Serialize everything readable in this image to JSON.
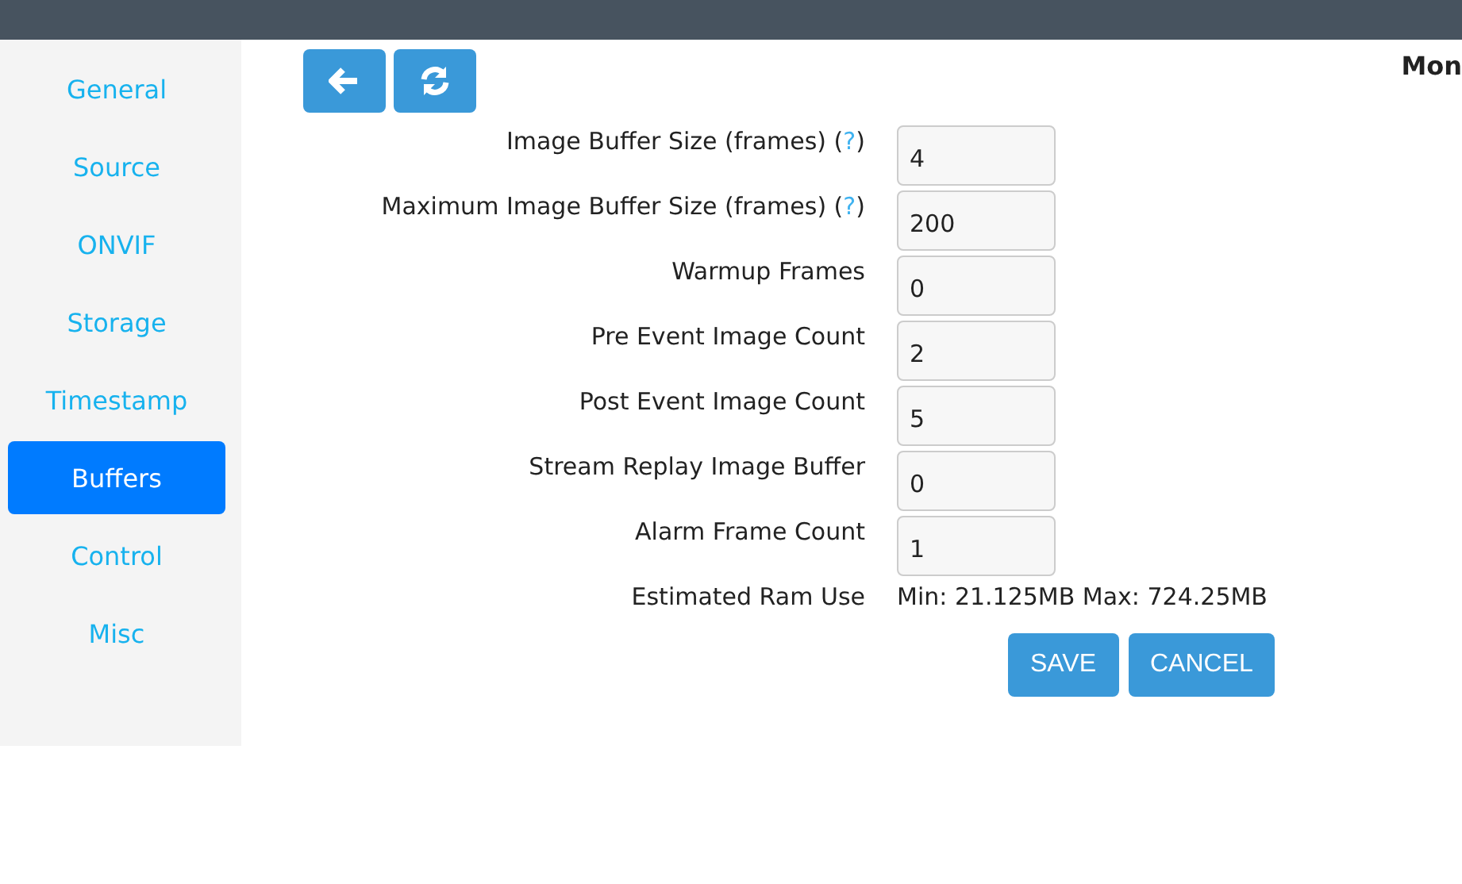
{
  "header": {
    "title": "Mon"
  },
  "sidebar": {
    "items": [
      {
        "label": "General",
        "selected": false
      },
      {
        "label": "Source",
        "selected": false
      },
      {
        "label": "ONVIF",
        "selected": false
      },
      {
        "label": "Storage",
        "selected": false
      },
      {
        "label": "Timestamp",
        "selected": false
      },
      {
        "label": "Buffers",
        "selected": true
      },
      {
        "label": "Control",
        "selected": false
      },
      {
        "label": "Misc",
        "selected": false
      }
    ]
  },
  "toolbar": [
    {
      "kind": "back"
    },
    {
      "kind": "refresh"
    }
  ],
  "fields": [
    {
      "kind": "input",
      "label": "Image Buffer Size (frames) (",
      "help": "?",
      "label_end": ")",
      "value": "4"
    },
    {
      "kind": "input",
      "label": "Maximum Image Buffer Size (frames) (",
      "help": "?",
      "label_end": ")",
      "value": "200"
    },
    {
      "kind": "input",
      "label": "Warmup Frames",
      "value": "0"
    },
    {
      "kind": "input",
      "label": "Pre Event Image Count",
      "value": "2"
    },
    {
      "kind": "input",
      "label": "Post Event Image Count",
      "value": "5"
    },
    {
      "kind": "input",
      "label": "Stream Replay Image Buffer",
      "value": "0"
    },
    {
      "kind": "input",
      "label": "Alarm Frame Count",
      "value": "1"
    },
    {
      "kind": "text",
      "label": "Estimated Ram Use",
      "value": "Min: 21.125MB Max: 724.25MB"
    }
  ],
  "buttons": [
    "SAVE",
    "CANCEL"
  ]
}
